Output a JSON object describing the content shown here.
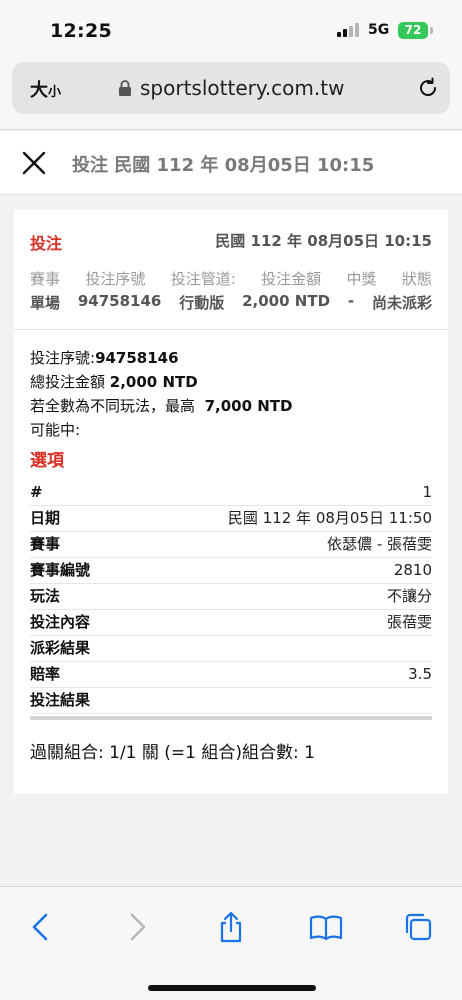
{
  "status_bar": {
    "time": "12:25",
    "network": "5G",
    "battery": "72"
  },
  "browser": {
    "text_size_label": "大",
    "text_size_small": "小",
    "url": "sportslottery.com.tw"
  },
  "header": {
    "title": "投注 民國 112 年 08月05日 10:15"
  },
  "summary": {
    "label": "投注",
    "date": "民國 112 年 08月05日 10:15",
    "columns": [
      "賽事",
      "投注序號",
      "投注管道:",
      "投注金額",
      "中獎",
      "狀態"
    ],
    "values": [
      "單場",
      "94758146",
      "行動版",
      "2,000 NTD",
      "-",
      "尚未派彩"
    ]
  },
  "details": {
    "serial_label": "投注序號:",
    "serial_value": "94758146",
    "total_label": "總投注金額",
    "total_value": "2,000 NTD",
    "max_label": "若全數為不同玩法，最高",
    "max_value": "7,000 NTD",
    "possible_label": "可能中:",
    "options_title": "選項",
    "rows": [
      {
        "key": "#",
        "value": "1"
      },
      {
        "key": "日期",
        "value": "民國 112 年 08月05日 11:50"
      },
      {
        "key": "賽事",
        "value": "依瑟儂 - 張蓓雯"
      },
      {
        "key": "賽事編號",
        "value": "2810"
      },
      {
        "key": "玩法",
        "value": "不讓分"
      },
      {
        "key": "投注內容",
        "value": "張蓓雯"
      },
      {
        "key": "派彩結果",
        "value": ""
      },
      {
        "key": "賠率",
        "value": "3.5"
      },
      {
        "key": "投注結果",
        "value": ""
      }
    ],
    "combination": "過關組合: 1/1 關 (=1 組合)組合數: 1"
  },
  "icons": {
    "close": "close-icon",
    "lock": "lock-icon",
    "reload": "reload-icon",
    "back": "back-icon",
    "forward": "forward-icon",
    "share": "share-icon",
    "bookmarks": "bookmarks-icon",
    "tabs": "tabs-icon"
  },
  "colors": {
    "accent_red": "#d93025",
    "battery_green": "#34c759",
    "link_blue": "#1a73e8"
  }
}
